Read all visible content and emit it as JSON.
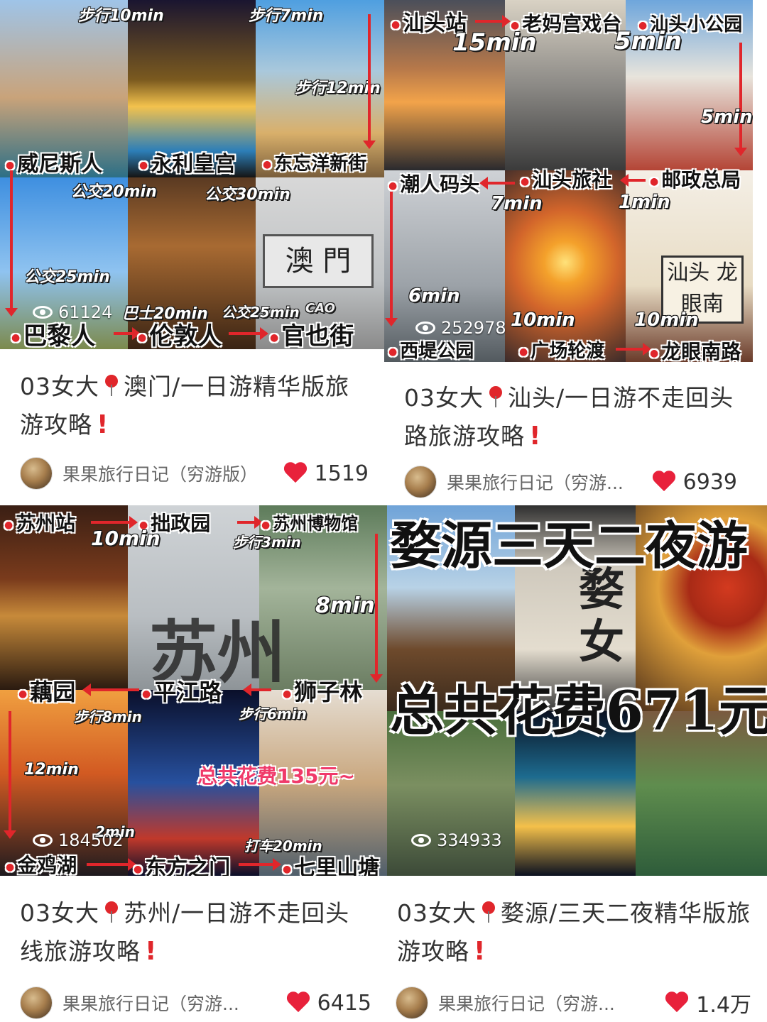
{
  "cards": [
    {
      "cover": {
        "places": [
          "威尼斯人",
          "永利皇宫",
          "东忘洋新街",
          "巴黎人",
          "伦敦人",
          "官也街"
        ],
        "times": [
          "步行10min",
          "步行7min",
          "步行12min",
          "公交20min",
          "公交30min",
          "公交25min",
          "巴士20min",
          "公交25min"
        ],
        "sign": {
          "text": "澳  門",
          "sub": "CAO"
        }
      },
      "views": "61124",
      "title_prefix": "03女大",
      "title_text": "澳门/一日游精华版旅游攻略",
      "author": "果果旅行日记（穷游版）",
      "likes": "1519"
    },
    {
      "cover": {
        "places": [
          "汕头站",
          "老妈宫戏台",
          "汕头小公园",
          "潮人码头",
          "汕头旅社",
          "邮政总局",
          "西堤公园",
          "广场轮渡",
          "龙眼南路"
        ],
        "times": [
          "15min",
          "5min",
          "5min",
          "7min",
          "1min",
          "6min",
          "10min",
          "10min"
        ],
        "sign": {
          "text": "汕头 龙眼南"
        }
      },
      "views": "252978",
      "title_prefix": "03女大",
      "title_text": "汕头/一日游不走回头路旅游攻略",
      "author": "果果旅行日记（穷游...",
      "likes": "6939"
    },
    {
      "cover": {
        "places": [
          "苏州站",
          "拙政园",
          "苏州博物馆",
          "藕园",
          "平江路",
          "狮子林",
          "金鸡湖",
          "东方之门",
          "七里山塘"
        ],
        "times": [
          "10min",
          "步行3min",
          "8min",
          "步行8min",
          "步行6min",
          "12min",
          "2min",
          "打车20min"
        ],
        "wall": "苏州",
        "highlight": "总共花费135元~"
      },
      "views": "184502",
      "title_prefix": "03女大",
      "title_text": "苏州/一日游不走回头线旅游攻略",
      "author": "果果旅行日记（穷游...",
      "likes": "6415"
    },
    {
      "cover": {
        "headline": "婺源三天二夜游",
        "cost": "总共花费671元",
        "wall": "婺女"
      },
      "views": "334933",
      "title_prefix": "03女大",
      "title_text": "婺源/三天二夜精华版旅游攻略",
      "author": "果果旅行日记（穷游...",
      "likes": "1.4万"
    }
  ],
  "colors": {
    "accent": "#e0262b",
    "heart": "#e8213b",
    "text": "#333333",
    "muted": "#666666"
  }
}
